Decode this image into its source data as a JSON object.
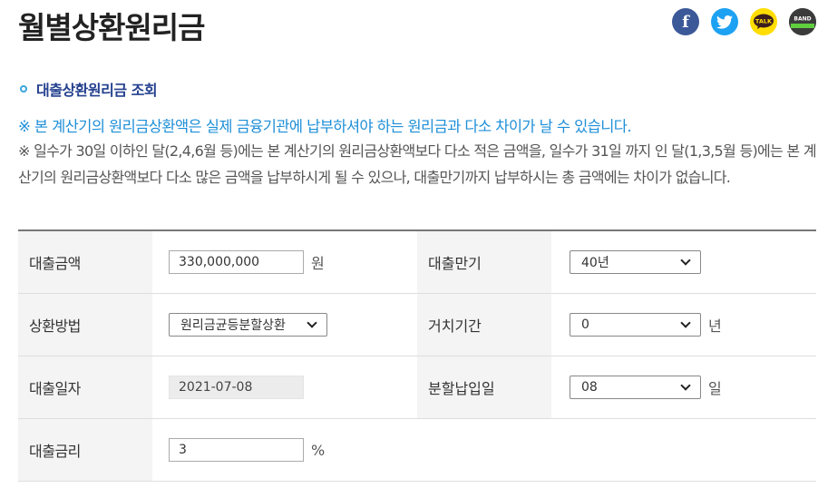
{
  "page": {
    "title": "월별상환원리금"
  },
  "share": {
    "facebook_label": "f",
    "kakaotalk_label": "TALK",
    "band_label": "BAND",
    "icons": [
      "facebook-icon",
      "twitter-icon",
      "kakaotalk-icon",
      "band-icon"
    ],
    "colors": {
      "facebook": "#3b5998",
      "twitter": "#1da1f2",
      "kakaotalk": "#ffdd00",
      "band": "#3b3b3b"
    }
  },
  "section": {
    "title": "대출상환원리금 조회"
  },
  "notice": "※ 본 계산기의 원리금상환액은 실제 금융기관에 납부하셔야 하는 원리금과 다소 차이가 날 수 있습니다.",
  "description": "※ 일수가 30일 이하인 달(2,4,6월 등)에는 본 계산기의 원리금상환액보다 다소 적은 금액을, 일수가 31일 까지 인 달(1,3,5월 등)에는 본 계산기의 원리금상환액보다 다소 많은 금액을 납부하시게 될 수 있으나, 대출만기까지 납부하시는 총 금액에는 차이가 없습니다.",
  "form": {
    "loan_amount": {
      "label": "대출금액",
      "value": "330,000,000",
      "unit": "원"
    },
    "loan_term": {
      "label": "대출만기",
      "value": "40년"
    },
    "repay_method": {
      "label": "상환방법",
      "value": "원리금균등분할상환"
    },
    "grace_period": {
      "label": "거치기간",
      "value": "0",
      "unit": "년"
    },
    "loan_date": {
      "label": "대출일자",
      "value": "2021-07-08"
    },
    "payment_day": {
      "label": "분할납입일",
      "value": "08",
      "unit": "일"
    },
    "interest_rate": {
      "label": "대출금리",
      "value": "3",
      "unit": "%"
    }
  }
}
